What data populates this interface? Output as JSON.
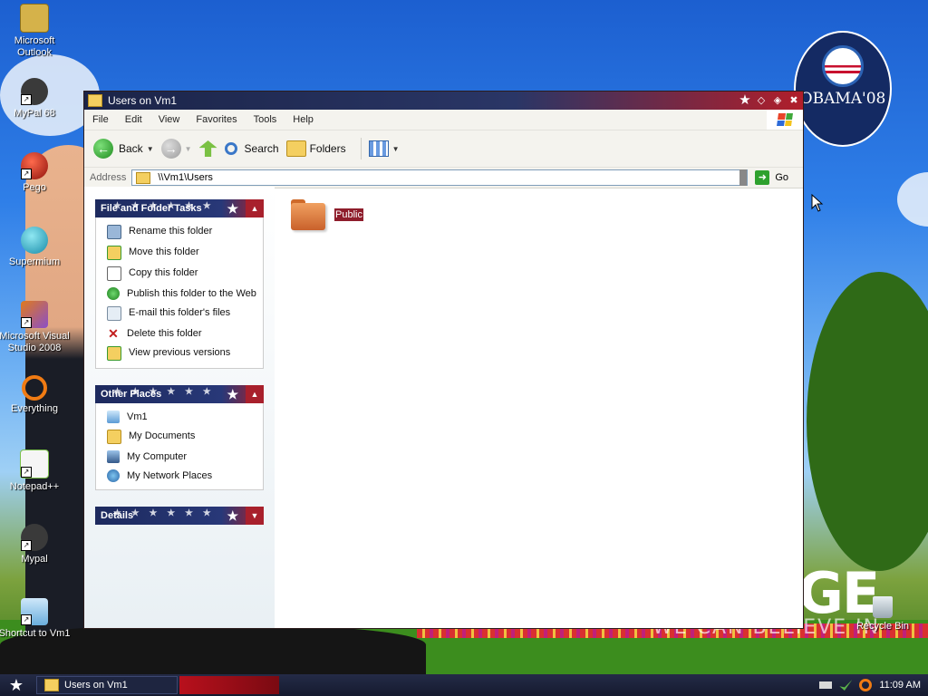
{
  "desktop": {
    "icons": [
      {
        "label": "Microsoft Outlook",
        "color": "#d5b24a"
      },
      {
        "label": "MyPal 68",
        "color": "#3a3a3a"
      },
      {
        "label": "Pego",
        "color": "#c1281d"
      },
      {
        "label": "Supermium",
        "color": "#24a8c9"
      },
      {
        "label": "Microsoft Visual Studio 2008",
        "color": "#e07a1c"
      },
      {
        "label": "Everything",
        "color": "#f07b13"
      },
      {
        "label": "Notepad++",
        "color": "#7bc04a"
      },
      {
        "label": "Mypal",
        "color": "#3a3a3a"
      },
      {
        "label": "Shortcut to Vm1",
        "color": "#8ac3e8"
      }
    ],
    "recycle_bin": "Recycle Bin",
    "badge": {
      "title": "OBAMA'08"
    },
    "slogan_big": "GE",
    "slogan_small": "WE CAN BELIEVE IN"
  },
  "window": {
    "title": "Users on Vm1",
    "menu": [
      "File",
      "Edit",
      "View",
      "Favorites",
      "Tools",
      "Help"
    ],
    "toolbar": {
      "back": "Back",
      "search": "Search",
      "folders": "Folders"
    },
    "address": {
      "label": "Address",
      "value": "\\\\Vm1\\Users",
      "go": "Go"
    },
    "panels": {
      "file_tasks": {
        "title": "File and Folder Tasks",
        "items": [
          "Rename this folder",
          "Move this folder",
          "Copy this folder",
          "Publish this folder to the Web",
          "E-mail this folder's files",
          "Delete this folder",
          "View previous versions"
        ]
      },
      "other_places": {
        "title": "Other Places",
        "items": [
          "Vm1",
          "My Documents",
          "My Computer",
          "My Network Places"
        ]
      },
      "details": {
        "title": "Details"
      }
    },
    "folders": [
      {
        "name": "Public",
        "selected": true
      }
    ]
  },
  "taskbar": {
    "task": "Users on Vm1",
    "clock": "11:09 AM"
  }
}
